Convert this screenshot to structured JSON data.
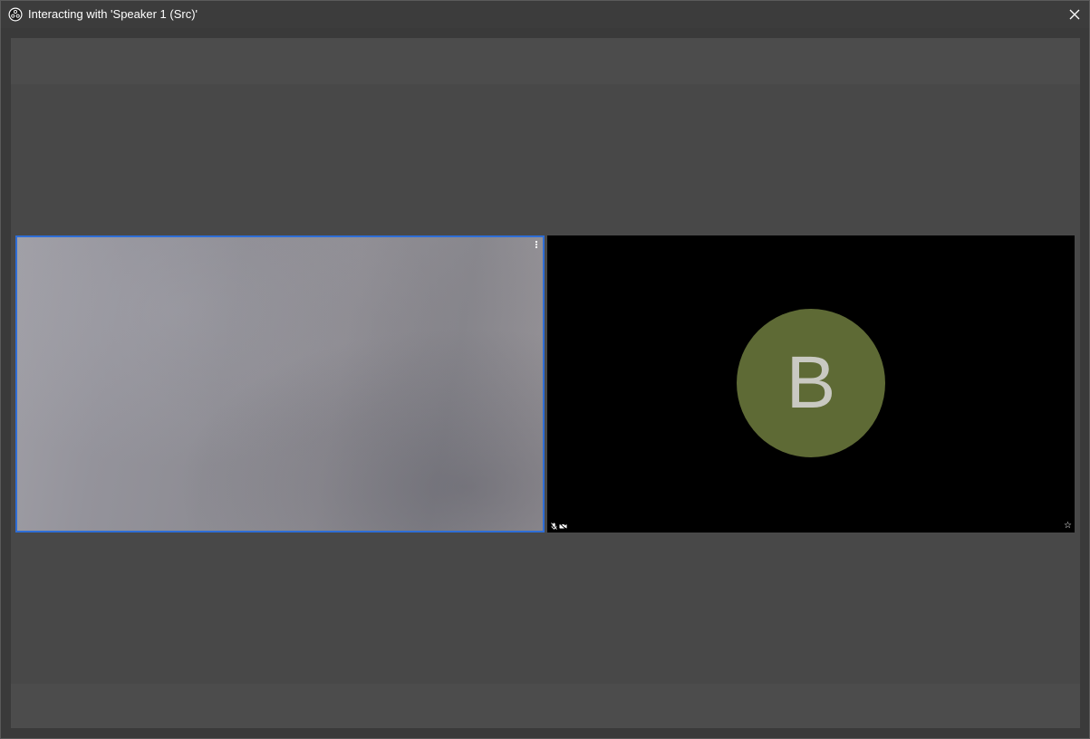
{
  "window": {
    "title": "Interacting with 'Speaker 1 (Src)'",
    "close_icon": "close-icon",
    "app_icon": "obs-logo-icon"
  },
  "tiles": [
    {
      "id": "local-video",
      "selected": true,
      "border_color": "#2f6ed6",
      "menu_icon": "more-vertical-icon"
    },
    {
      "id": "remote-participant",
      "avatar_letter": "B",
      "avatar_color": "#5e6a35",
      "status_icons": [
        "mic-muted-icon",
        "camera-off-icon"
      ],
      "pin_icon": "star-icon"
    }
  ]
}
